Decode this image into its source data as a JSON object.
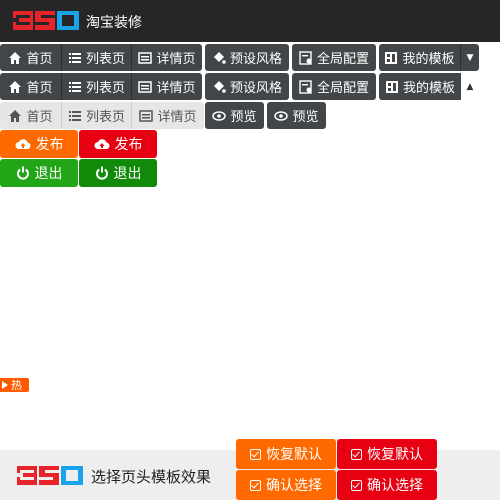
{
  "header": {
    "logo_text": "350",
    "title": "淘宝装修"
  },
  "toolbar_row1": {
    "items": [
      "首页",
      "列表页",
      "详情页",
      "预设风格",
      "全局配置",
      "我的模板"
    ]
  },
  "toolbar_row2": {
    "items": [
      "首页",
      "列表页",
      "详情页",
      "预设风格",
      "全局配置",
      "我的模板"
    ]
  },
  "toolbar_row3": {
    "items": [
      "首页",
      "列表页",
      "详情页",
      "预览",
      "预览"
    ]
  },
  "actions": {
    "publish_orange": "发布",
    "publish_red": "发布",
    "exit_green": "退出",
    "exit_dark_green": "退出"
  },
  "hot_badge": "热",
  "footer": {
    "logo_text": "350",
    "title": "选择页头模板效果",
    "restore_orange": "恢复默认",
    "restore_red": "恢复默认",
    "confirm_orange": "确认选择",
    "confirm_red": "确认选择"
  },
  "colors": {
    "topbar": "#262626",
    "toolbar_dark": "#424649",
    "toolbar_light": "#e6e6e6",
    "orange": "#ff6a00",
    "red": "#e60012",
    "green": "#22a516",
    "dark_green": "#118a0a",
    "logo_red": "#e8232a",
    "logo_blue": "#1aa3e8"
  }
}
